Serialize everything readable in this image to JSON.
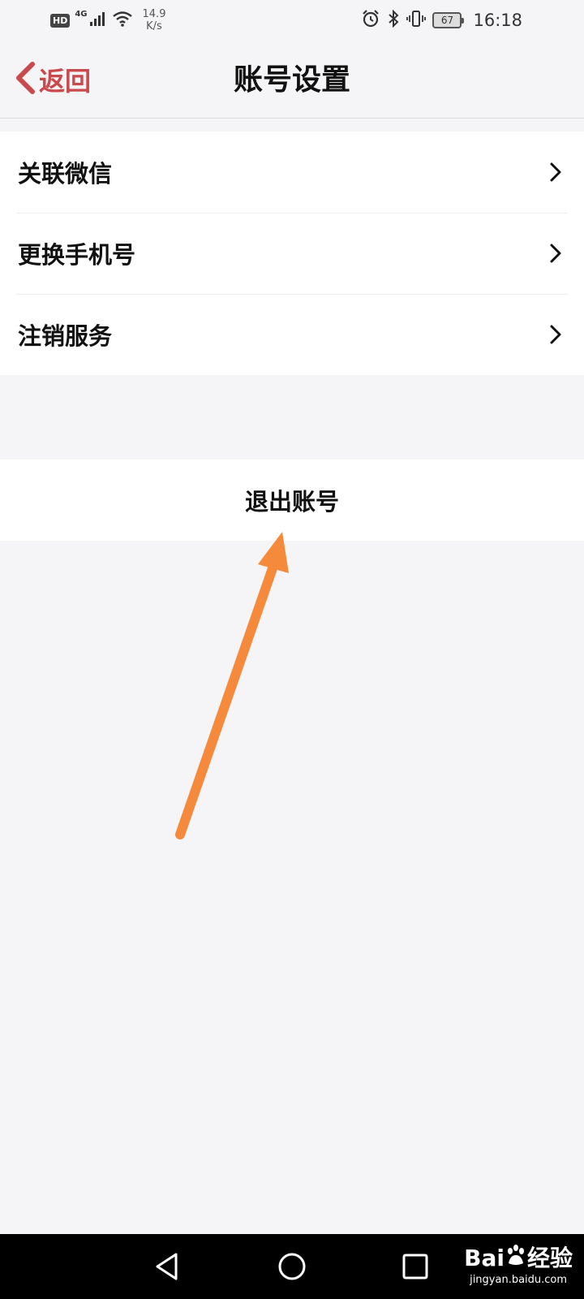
{
  "status_bar": {
    "hd": "HD",
    "network": "4G",
    "speed_value": "14.9",
    "speed_unit": "K/s",
    "battery": "67",
    "time": "16:18",
    "icons": [
      "signal-icon",
      "wifi-icon",
      "alarm-icon",
      "bluetooth-icon",
      "vibrate-icon",
      "battery-icon"
    ]
  },
  "header": {
    "back_label": "返回",
    "title": "账号设置"
  },
  "settings": {
    "items": [
      {
        "label": "关联微信"
      },
      {
        "label": "更换手机号"
      },
      {
        "label": "注销服务"
      }
    ]
  },
  "logout": {
    "label": "退出账号"
  },
  "colors": {
    "accent": "#c9494c",
    "background": "#f5f5f7",
    "annotation_arrow": "#f68a3c"
  },
  "watermark": {
    "logo_left": "Bai",
    "logo_right": "经验",
    "url": "jingyan.baidu.com"
  }
}
